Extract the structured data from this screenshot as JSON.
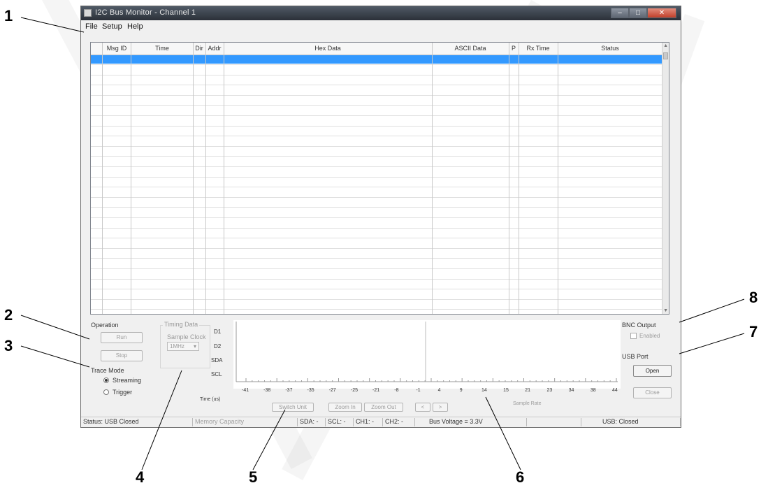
{
  "window": {
    "title": "I2C Bus Monitor - Channel 1",
    "menu": [
      "File",
      "Setup",
      "Help"
    ]
  },
  "grid": {
    "columns": [
      "Msg ID",
      "Time",
      "Dir",
      "Addr",
      "Hex Data",
      "ASCII Data",
      "P",
      "Rx Time",
      "Status"
    ]
  },
  "operation": {
    "label": "Operation",
    "run_label": "Run",
    "stop_label": "Stop"
  },
  "trace_mode": {
    "label": "Trace Mode",
    "options": [
      "Streaming",
      "Trigger"
    ],
    "selected": "Streaming"
  },
  "timing": {
    "label": "Timing Data",
    "sample_label": "Sample Clock",
    "sample_value": "1MHz"
  },
  "plot": {
    "y_labels": [
      "D1",
      "D2",
      "SDA",
      "SCL"
    ],
    "x_ticks": [
      "-41",
      "-38",
      "-37",
      "-35",
      "-27",
      "-25",
      "-21",
      "-8",
      "-1",
      "4",
      "9",
      "14",
      "15",
      "21",
      "23",
      "34",
      "38",
      "44"
    ],
    "x_label": "Time (us)"
  },
  "controls": {
    "buttons": [
      "Switch Unit",
      "Zoom In",
      "Zoom Out",
      "<",
      ">"
    ],
    "sample_rate": "Sample Rate"
  },
  "bnc": {
    "label": "BNC Output",
    "checkbox": "Enabled"
  },
  "usb": {
    "label": "USB Port",
    "open": "Open",
    "close": "Close"
  },
  "statusbar": {
    "status": "Status: USB Closed",
    "memory": "Memory Capacity",
    "sda": "SDA: -",
    "scl": "SCL: -",
    "ch1": "CH1: -",
    "ch2": "CH2: -",
    "bus_voltage": "Bus Voltage = 3.3V",
    "usb": "USB: Closed"
  },
  "callouts": [
    "1",
    "2",
    "3",
    "4",
    "5",
    "6",
    "7",
    "8"
  ]
}
